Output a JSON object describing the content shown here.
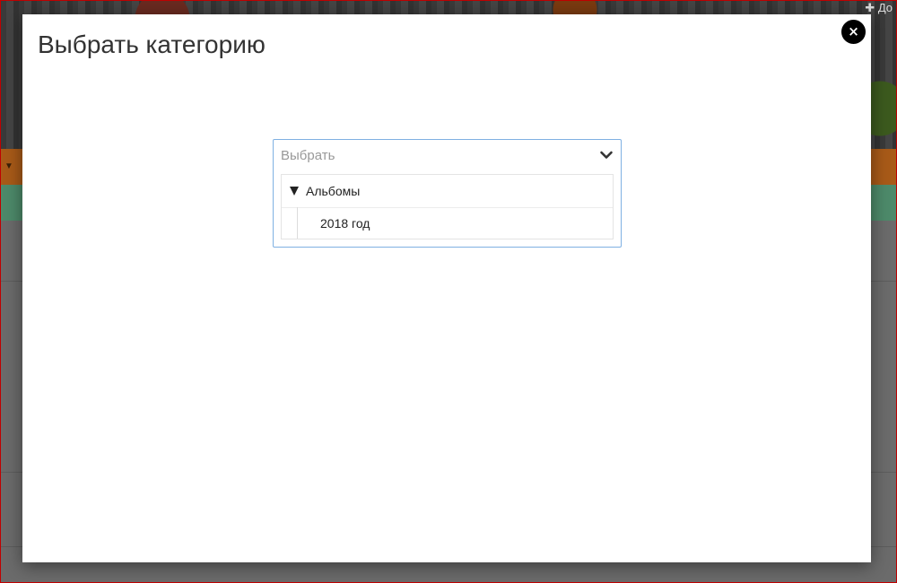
{
  "background": {
    "corner_note": "✚ До"
  },
  "modal": {
    "title": "Выбрать категорию",
    "close_symbol": "×"
  },
  "select": {
    "placeholder": "Выбрать",
    "tree": {
      "group_label": "Альбомы",
      "expanded": true,
      "items": [
        {
          "label": "2018 год"
        }
      ]
    }
  },
  "colors": {
    "accent_border": "#7fb0e2",
    "close_button": "#000000",
    "window_frame": "#c00000"
  },
  "icons": {
    "close": "close-icon",
    "dropdown": "chevron-down-icon",
    "tree_toggle": "triangle-down-icon"
  }
}
